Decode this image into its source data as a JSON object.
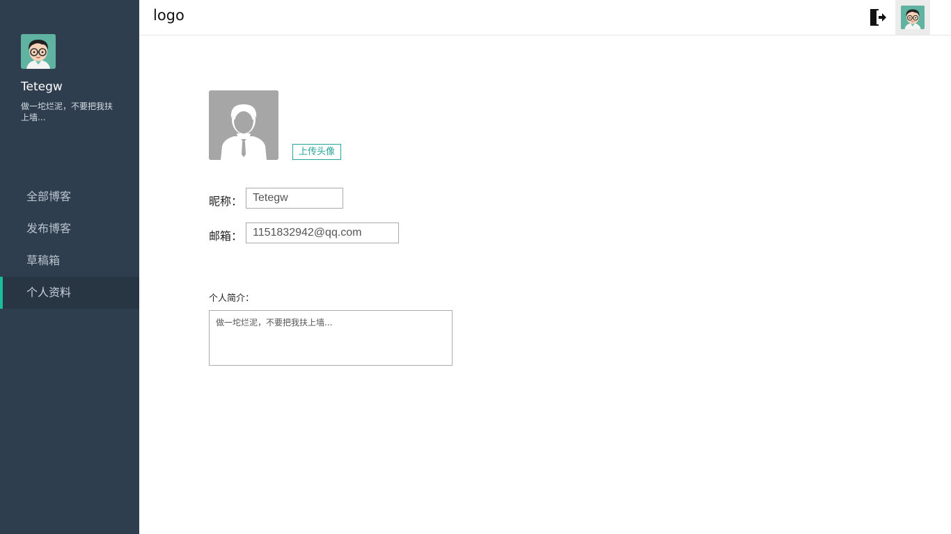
{
  "header": {
    "logo": "logo",
    "logout_icon": "logout-icon",
    "avatar_icon": "avatar-icon"
  },
  "sidebar": {
    "user_name": "Tetegw",
    "user_bio": "做一坨烂泥，不要把我扶上墙...",
    "nav": [
      {
        "label": "全部博客",
        "active": false
      },
      {
        "label": "发布博客",
        "active": false
      },
      {
        "label": "草稿箱",
        "active": false
      },
      {
        "label": "个人资料",
        "active": true
      }
    ]
  },
  "profile": {
    "upload_label": "上传头像",
    "nickname_label": "昵称：",
    "nickname_value": "Tetegw",
    "email_label": "邮箱：",
    "email_value": "1151832942@qq.com",
    "bio_label": "个人简介：",
    "bio_value": "做一坨烂泥，不要把我扶上墙..."
  },
  "colors": {
    "sidebar_bg": "#2f3e4e",
    "accent": "#1abc9c",
    "upload_border": "#26a69a"
  }
}
